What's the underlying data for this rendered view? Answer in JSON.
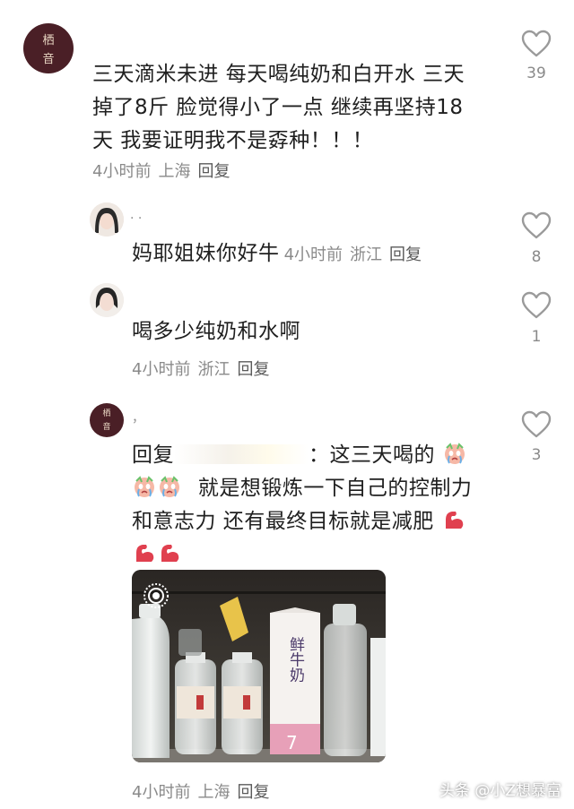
{
  "comments": [
    {
      "avatar_text": "栖 音",
      "text": [
        "三天滴米未进 每天喝纯奶和白开水 三天",
        "掉了8斤 脸觉得小了一点 继续再坚持18",
        "天 我要证明我不是孬种！！！"
      ],
      "time": "4小时前",
      "location": "上海",
      "reply_label": "回复",
      "likes": "39"
    }
  ],
  "replies": [
    {
      "username": "· ·",
      "text": "妈耶姐妹你好牛",
      "time": "4小时前",
      "location": "浙江",
      "reply_label": "回复",
      "likes": "8"
    },
    {
      "username": "",
      "text": "喝多少纯奶和水啊",
      "time": "4小时前",
      "location": "浙江",
      "reply_label": "回复",
      "likes": "1"
    },
    {
      "avatar_text": "栖 音",
      "username": "，",
      "reply_prefix": "回复",
      "colon_text": "：这三天喝的",
      "line2": "就是想锻炼一下自己的控制力",
      "line3": "和意志力 还有最终目标就是减肥",
      "time": "4小时前",
      "location": "上海",
      "reply_label": "回复",
      "likes": "3"
    }
  ],
  "photo": {
    "carton_brand": "鲜牛奶",
    "carton_number": "7"
  },
  "watermark": "头条 @小Z想暴富",
  "colors": {
    "meta": "#8a8a8a",
    "text": "#1f1f1f",
    "avatar_bg": "#4a1f26",
    "heart_stroke": "#9a9a9a"
  }
}
